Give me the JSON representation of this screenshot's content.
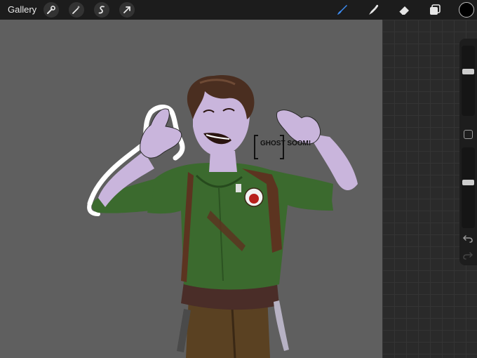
{
  "toolbar": {
    "gallery_label": "Gallery",
    "left_tools": [
      "wrench-icon",
      "magic-wand-icon",
      "selection-icon",
      "transform-arrow-icon"
    ],
    "right_tools": [
      "brush-icon",
      "smudge-icon",
      "eraser-icon",
      "layers-icon"
    ],
    "active_tool": "brush",
    "active_tool_color": "#3d8df5",
    "current_color": "#000000"
  },
  "canvas": {
    "background_color": "#5f5f5f",
    "artwork": "digital illustration of a smiling person in a green shirt",
    "signature_text": "GHOST SOOM!"
  },
  "sidebar": {
    "brush_size_level": 0.36,
    "opacity_level": 0.43,
    "buttons": [
      "modify-button",
      "undo-button",
      "redo-button"
    ]
  }
}
